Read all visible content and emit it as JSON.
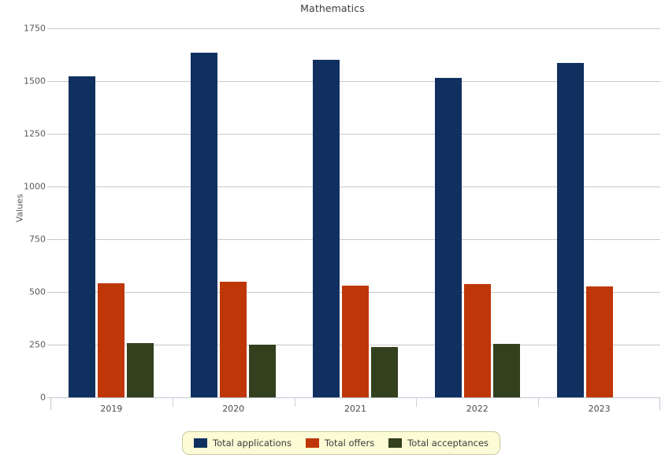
{
  "chart_data": {
    "type": "bar",
    "title": "Mathematics",
    "xlabel": "",
    "ylabel": "Values",
    "categories": [
      "2019",
      "2020",
      "2021",
      "2022",
      "2023"
    ],
    "series": [
      {
        "name": "Total applications",
        "color": "#103060",
        "values": [
          1522,
          1634,
          1601,
          1515,
          1586
        ]
      },
      {
        "name": "Total offers",
        "color": "#bf3708",
        "values": [
          541,
          547,
          531,
          537,
          526
        ]
      },
      {
        "name": "Total acceptances",
        "color": "#32401e",
        "values": [
          256,
          249,
          238,
          255,
          null
        ]
      }
    ],
    "ylim": [
      0,
      1750
    ],
    "yticks": [
      0,
      250,
      500,
      750,
      1000,
      1250,
      1500,
      1750
    ],
    "ytick_labels": [
      "0",
      "250",
      "500",
      "750",
      "1000",
      "1250",
      "1500",
      "1750"
    ],
    "grid": true,
    "legend_position": "bottom"
  },
  "legend": {
    "items": [
      {
        "label": "Total applications",
        "color": "#103060"
      },
      {
        "label": "Total offers",
        "color": "#bf3708"
      },
      {
        "label": "Total acceptances",
        "color": "#32401e"
      }
    ]
  },
  "colors": {
    "background": "#ffffff",
    "gridline": "#c8c8c8",
    "axis": "#bfc9d4",
    "text": "#4a4a4a",
    "legend_background": "#fbfbd5",
    "legend_border": "#c9c9a0"
  }
}
